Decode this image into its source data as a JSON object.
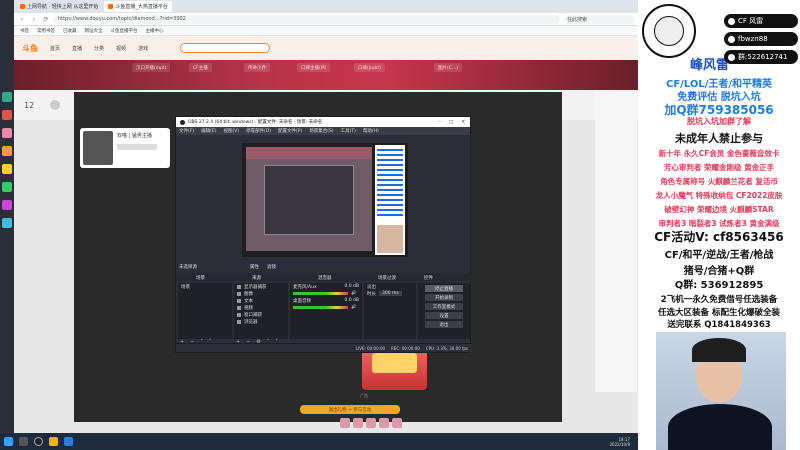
{
  "browser": {
    "tabs": [
      {
        "label": "上网导航 · 轻快上网 从这里开始",
        "active": false
      },
      {
        "label": "斗鱼直播_大热直播平台",
        "active": true
      }
    ],
    "url": "https://www.douyu.com/topic/diamond…?rid=3902",
    "search_placeholder": "在此搜索",
    "bookmarks": [
      "书签",
      "常用书签",
      "已收藏",
      "网址大全",
      "斗鱼直播平台",
      "主播中心"
    ]
  },
  "douyu": {
    "logo": "斗鱼",
    "nav": [
      "首页",
      "直播",
      "分类",
      "视频",
      "游戏"
    ],
    "room_tabs": [
      "汉口开播(mpl)",
      "CF主播",
      "传奇小乔",
      "口碑主播(M)",
      "口碑(pubt)",
      "图片(C...)"
    ],
    "level": "12",
    "anchor_name": "双喵 | 猛男主播",
    "promo_label": "广告",
    "gift_text": "送出礼物 + 参与互动"
  },
  "obs": {
    "title": "OBS 27.2.4 (64 bit, windows) - 配置文件: 未命名 - 场景: 未命名",
    "menu": [
      "文件(F)",
      "编辑(E)",
      "视图(V)",
      "停靠部件(D)",
      "配置文件(P)",
      "场景集合(S)",
      "工具(T)",
      "帮助(H)"
    ],
    "docks": [
      "场景",
      "来源",
      "混音器",
      "场景过渡",
      "控件"
    ],
    "scene_item": "场景",
    "sources": [
      "显示器捕获",
      "图像",
      "文本",
      "视频",
      "窗口捕获",
      "浏览器"
    ],
    "mixer": [
      {
        "name": "麦克风/Aux",
        "level": "0.0 dB"
      },
      {
        "name": "桌面音频",
        "level": "0.0 dB"
      }
    ],
    "transition": {
      "name": "淡出",
      "duration_label": "时长",
      "duration": "300 ms"
    },
    "controls": [
      "停止直播",
      "开始录制",
      "工作室模式",
      "设置",
      "退出"
    ],
    "status": [
      "LIVE: 00:00:00",
      "REC: 00:00:00",
      "CPU: 3.3%, 30.00 fps"
    ],
    "mode_buttons": [
      "属性",
      "滤镜"
    ],
    "preview_label": "未选择源"
  },
  "overlay": {
    "brand": "峰风雷",
    "contacts": [
      {
        "icon": "qq-icon",
        "text": "CF 风雷"
      },
      {
        "icon": "weibo-icon",
        "text": "fbwzn88"
      },
      {
        "icon": "wechat-icon",
        "text": "群:522612741"
      }
    ],
    "lines": [
      {
        "text": "CF/LOL/王者/和平精英",
        "color": "#1f7bd9"
      },
      {
        "text": "免费评估 脱坑入坑",
        "color": "#1f7bd9"
      },
      {
        "text": "加Q群759385056",
        "color": "#1f7bd9"
      },
      {
        "text": "脱坑入坑加群了解",
        "color": "#e23a5a"
      },
      {
        "text": "未成年人禁止参与",
        "color": "#111111"
      },
      {
        "text": "新十年 永久CF会员 金色蔷薇音效卡",
        "color": "#e23a5a"
      },
      {
        "text": "芳心审判者 荣耀金刚级 黄金正手",
        "color": "#e23a5a"
      },
      {
        "text": "角色专属称号 火麒麟兰花者 复活币",
        "color": "#e23a5a"
      },
      {
        "text": "龙人小魔气 特殊收纳包 CF2022皮肤",
        "color": "#e23a5a"
      },
      {
        "text": "破壁幻神 荣耀边境 火麒麟STAR",
        "color": "#e23a5a"
      },
      {
        "text": "审判者3 暗裂者3 试炼者3 黄金满级",
        "color": "#e23a5a"
      },
      {
        "text": "CF活动V: cf8563456",
        "color": "#111111"
      },
      {
        "text": "CF/和平/逆战/王者/枪战",
        "color": "#111111"
      },
      {
        "text": "猪号/合猪+Q群",
        "color": "#111111"
      },
      {
        "text": "Q群: 536912895",
        "color": "#111111"
      },
      {
        "text": "2飞机一永久免费借号任选装备",
        "color": "#111111"
      },
      {
        "text": "任选大区装备 标配生化爆破全装",
        "color": "#111111"
      },
      {
        "text": "送完联系 Q1841849363",
        "color": "#111111"
      }
    ]
  },
  "taskbar": {
    "time": "18:17",
    "date": "2022/10/9"
  },
  "colors": {
    "douyu_orange": "#ff7c00",
    "obs_bg": "#2b2e38",
    "overlay_blue": "#1f7bd9",
    "overlay_red": "#e23a5a"
  }
}
